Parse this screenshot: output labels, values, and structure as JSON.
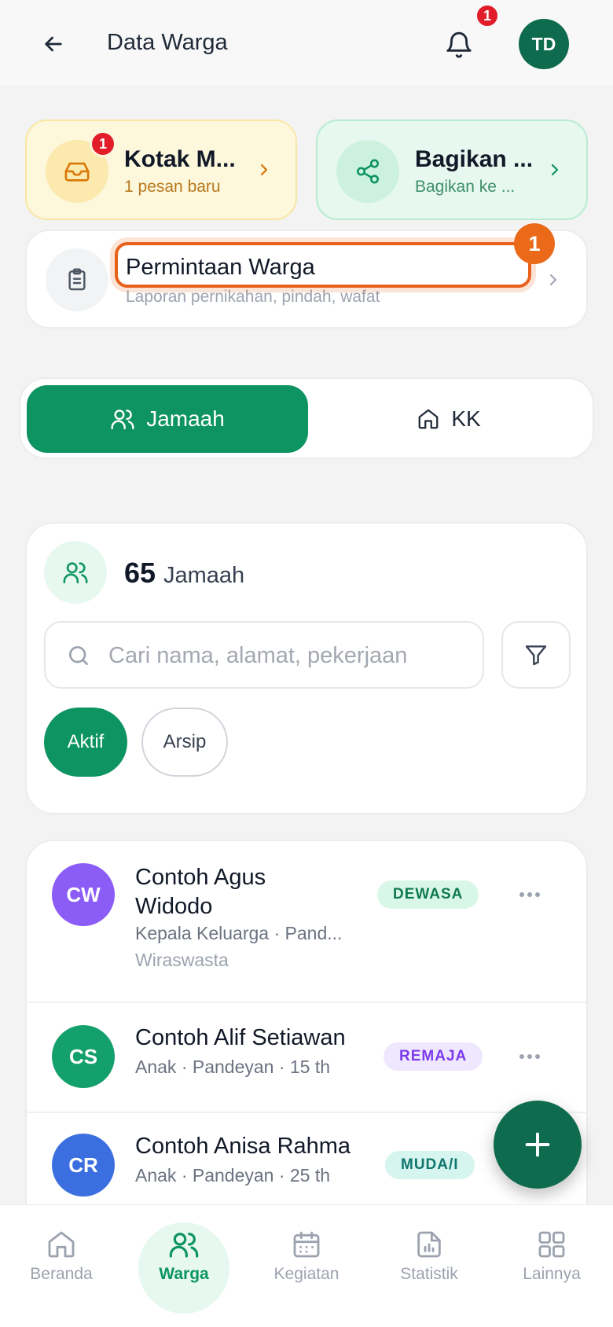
{
  "header": {
    "title": "Data Warga",
    "notification_count": "1",
    "avatar_initials": "TD"
  },
  "quick_cards": {
    "inbox": {
      "title": "Kotak M...",
      "subtitle": "1 pesan baru",
      "badge": "1"
    },
    "share": {
      "title": "Bagikan ...",
      "subtitle": "Bagikan ke ..."
    }
  },
  "request_card": {
    "title": "Permintaan Warga",
    "subtitle": "Laporan pernikahan, pindah, wafat",
    "step_marker": "1"
  },
  "segment_tabs": [
    {
      "label": "Jamaah",
      "active": true
    },
    {
      "label": "KK",
      "active": false
    }
  ],
  "summary": {
    "count": "65",
    "count_label": "Jamaah"
  },
  "search": {
    "placeholder": "Cari nama, alamat, pekerjaan",
    "value": ""
  },
  "status_chips": [
    {
      "label": "Aktif",
      "active": true
    },
    {
      "label": "Arsip",
      "active": false
    }
  ],
  "members": [
    {
      "initials": "CW",
      "name_line1": "Contoh Agus",
      "name_line2": "Widodo",
      "meta": "Kepala Keluarga · Pand...",
      "job": "Wiraswasta",
      "badge": "DEWASA",
      "avatar_color": "#8b5cf6",
      "badge_bg": "#d9f7e8",
      "badge_fg": "#0f7a4f"
    },
    {
      "initials": "CS",
      "name_line1": "Contoh Alif Setiawan",
      "meta": "Anak · Pandeyan · 15 th",
      "badge": "REMAJA",
      "avatar_color": "#14a06d",
      "badge_bg": "#efe7fd",
      "badge_fg": "#7c3aed"
    },
    {
      "initials": "CR",
      "name_line1": "Contoh Anisa Rahma",
      "meta": "Anak · Pandeyan · 25 th",
      "badge": "MUDA/I",
      "avatar_color": "#3b6fe0",
      "badge_bg": "#d6f5ee",
      "badge_fg": "#0f766e"
    }
  ],
  "bottom_nav": [
    {
      "label": "Beranda",
      "icon": "home-icon",
      "active": false
    },
    {
      "label": "Warga",
      "icon": "users-icon",
      "active": true
    },
    {
      "label": "Kegiatan",
      "icon": "calendar-icon",
      "active": false
    },
    {
      "label": "Statistik",
      "icon": "report-icon",
      "active": false
    },
    {
      "label": "Lainnya",
      "icon": "grid-icon",
      "active": false
    }
  ],
  "colors": {
    "primary": "#0d9462",
    "primary_dark": "#0e6b4d",
    "highlight": "#e8621c",
    "alert": "#e11d2a"
  }
}
